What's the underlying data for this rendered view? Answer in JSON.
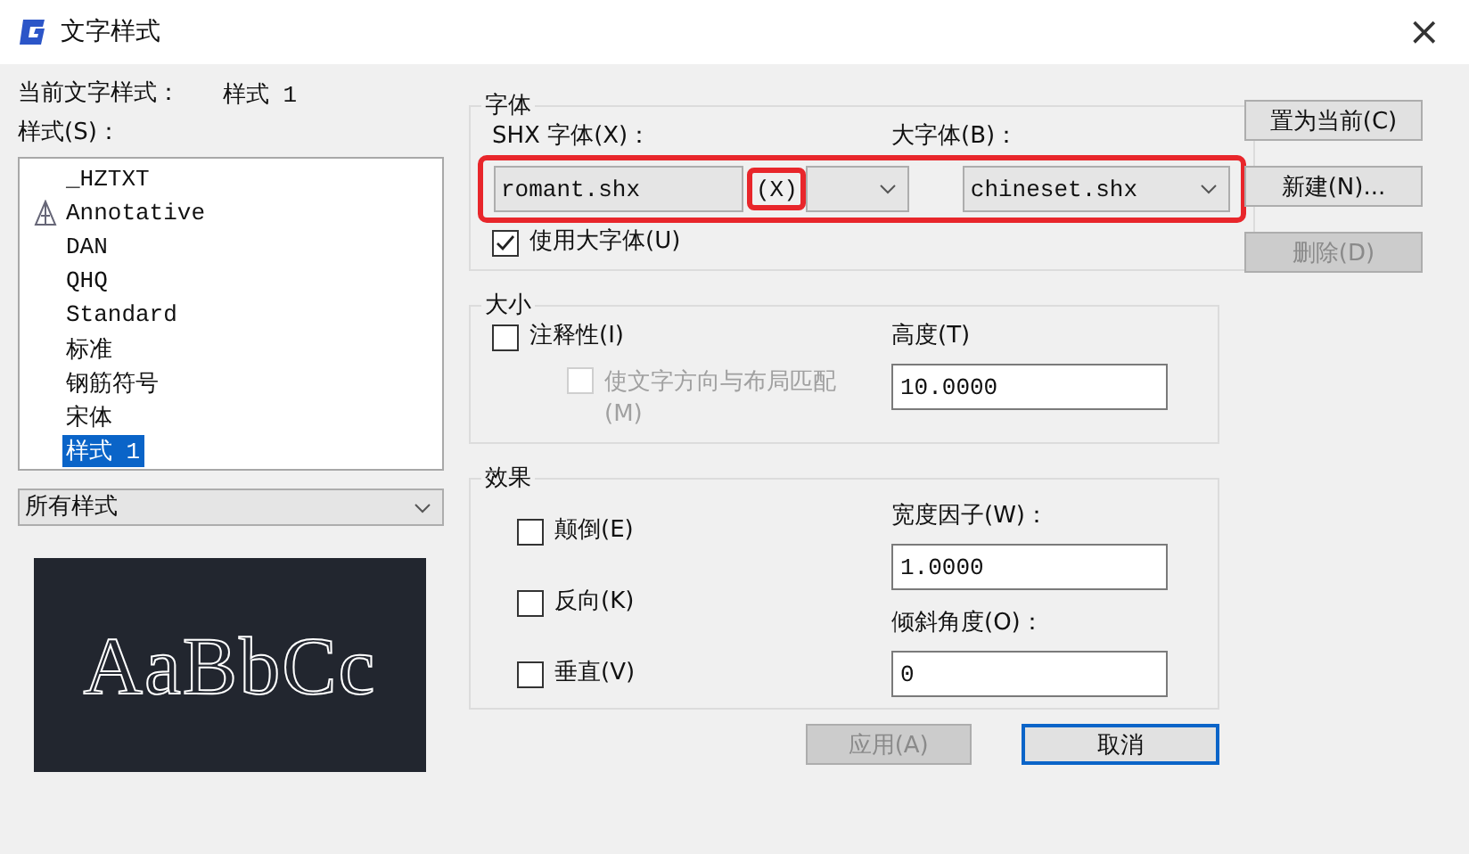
{
  "window": {
    "title": "文字样式",
    "close": "×"
  },
  "current_style": {
    "label": "当前文字样式：",
    "value": "样式 1"
  },
  "styles": {
    "label": "样式(S)：",
    "items": [
      {
        "name": "_HZTXT",
        "annotative": false,
        "selected": false
      },
      {
        "name": "Annotative",
        "annotative": true,
        "selected": false
      },
      {
        "name": "DAN",
        "annotative": false,
        "selected": false
      },
      {
        "name": "QHQ",
        "annotative": false,
        "selected": false
      },
      {
        "name": "Standard",
        "annotative": false,
        "selected": false
      },
      {
        "name": "标准",
        "annotative": false,
        "selected": false
      },
      {
        "name": "钢筋符号",
        "annotative": false,
        "selected": false
      },
      {
        "name": "宋体",
        "annotative": false,
        "selected": false
      },
      {
        "name": "样式 1",
        "annotative": false,
        "selected": true
      }
    ]
  },
  "filter": {
    "value": "所有样式"
  },
  "preview": {
    "text": "AaBbCc"
  },
  "font": {
    "title": "字体",
    "shx_label": "SHX 字体(X)：",
    "shx_value": "romant.shx",
    "big_label": "大字体(B)：",
    "big_value": "chineset.shx",
    "use_big": {
      "label": "使用大字体(U)",
      "checked": true
    }
  },
  "annotations": {
    "callout": "(X)"
  },
  "size": {
    "title": "大小",
    "annotative": {
      "label": "注释性(I)",
      "checked": false
    },
    "match": {
      "label": "使文字方向与布局匹配(M)",
      "checked": false,
      "disabled": true
    },
    "height_label": "高度(T)",
    "height_value": "10.0000"
  },
  "effects": {
    "title": "效果",
    "checks": [
      {
        "label": "颠倒(E)",
        "checked": false
      },
      {
        "label": "反向(K)",
        "checked": false
      },
      {
        "label": "垂直(V)",
        "checked": false
      }
    ],
    "width_label": "宽度因子(W)：",
    "width_value": "1.0000",
    "oblique_label": "倾斜角度(O)：",
    "oblique_value": "0"
  },
  "side_buttons": [
    {
      "label": "置为当前(C)",
      "disabled": false
    },
    {
      "label": "新建(N)...",
      "disabled": false
    },
    {
      "label": "删除(D)",
      "disabled": true
    }
  ],
  "bottom_buttons": [
    {
      "label": "应用(A)",
      "disabled": true,
      "focused": false
    },
    {
      "label": "取消",
      "disabled": false,
      "focused": true
    }
  ]
}
